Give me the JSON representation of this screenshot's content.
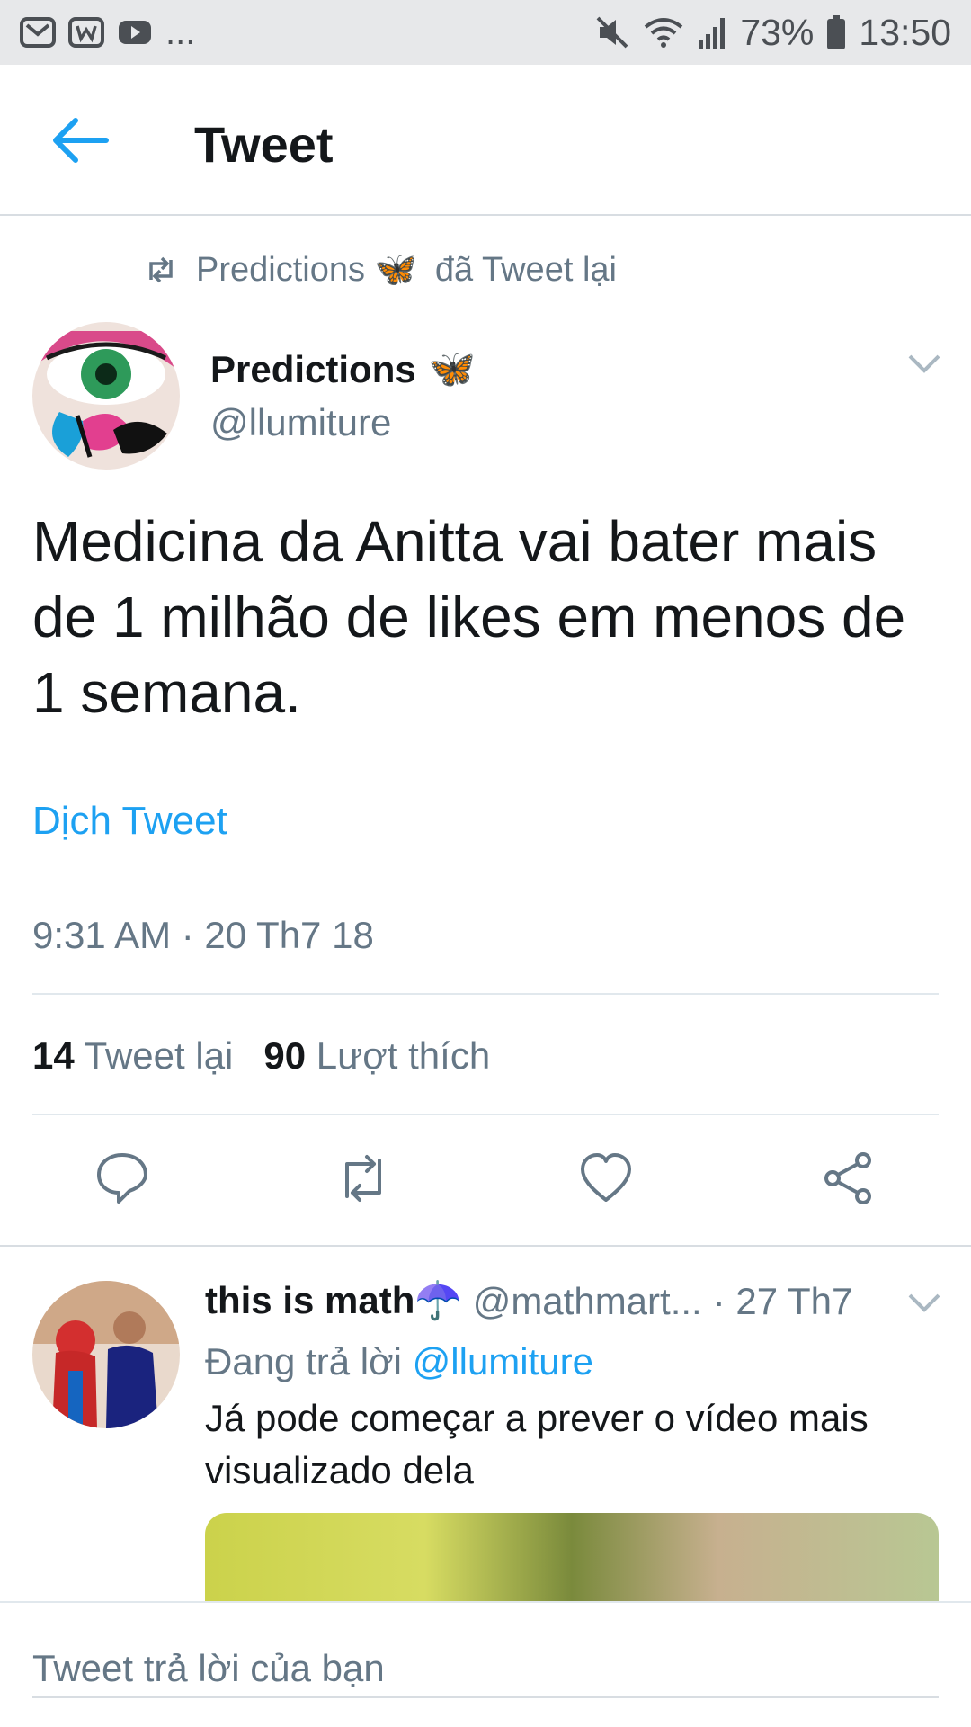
{
  "status_bar": {
    "left_icons": [
      "mail-icon",
      "app-w-icon",
      "youtube-icon"
    ],
    "more": "...",
    "battery": "73%",
    "time": "13:50"
  },
  "header": {
    "title": "Tweet"
  },
  "retweet_context": {
    "name": "Predictions 🦋",
    "text": "đã Tweet lại"
  },
  "tweet": {
    "display_name": "Predictions",
    "name_emoji": "🦋",
    "handle": "@llumiture",
    "text": "Medicina da Anitta vai bater mais de 1 milhão de likes em menos de 1 semana.",
    "translate_label": "Dịch Tweet",
    "timestamp": "9:31 AM · 20 Th7 18",
    "retweet_count": "14",
    "retweet_label": "Tweet lại",
    "like_count": "90",
    "like_label": "Lượt thích"
  },
  "actions": [
    "reply-icon",
    "retweet-icon",
    "like-icon",
    "share-icon"
  ],
  "reply": {
    "display_name": "this is math☂️",
    "handle": "@mathmart...",
    "time": "· 27 Th7",
    "replying_prefix": "Đang trả lời",
    "replying_to": "@llumiture",
    "text": "Já pode começar a prever o vídeo mais visualizado dela"
  },
  "compose": {
    "placeholder": "Tweet trả lời của bạn"
  },
  "colors": {
    "accent": "#1da1f2",
    "muted": "#657786",
    "text": "#14171a"
  }
}
